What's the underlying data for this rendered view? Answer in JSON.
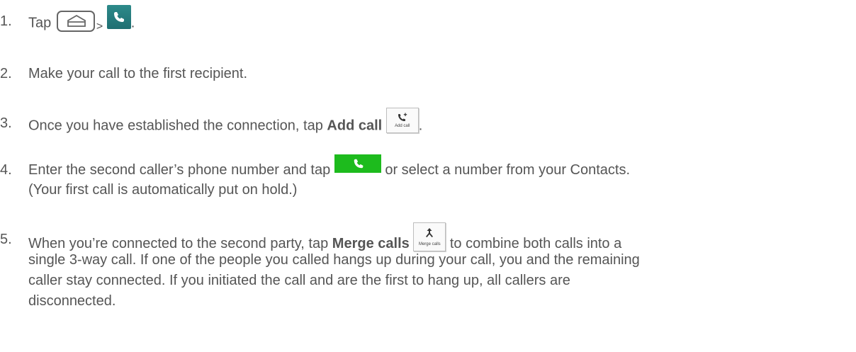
{
  "steps": [
    {
      "number": "1.",
      "tap": "Tap",
      "sep": ">",
      "end": ".",
      "icons": [
        "home-key-icon",
        "phone-app-icon"
      ]
    },
    {
      "number": "2.",
      "text": "Make your call to the first recipient."
    },
    {
      "number": "3.",
      "text_before": "Once you have established the connection, tap",
      "bold": "Add call",
      "icon_caption": "Add call",
      "end": "."
    },
    {
      "number": "4.",
      "text_before": "Enter the second caller’s phone number and tap",
      "text_after": "or select a number from your Contacts.",
      "line2": "(Your first call is automatically put on hold.)"
    },
    {
      "number": "5.",
      "text_before": "When you’re connected to the second party, tap",
      "bold": "Merge calls",
      "icon_caption": "Merge calls",
      "text_after": "to combine both calls into a",
      "line2": "single 3-way call. If one of the people you called hangs up during your call, you and the remaining",
      "line3": "caller stay connected. If you initiated the call and are the first to hang up, all callers are",
      "line4": "disconnected."
    }
  ],
  "colors": {
    "text": "#555555",
    "phone_tile": "#2d8a8a",
    "call_button": "#1dbb1d"
  }
}
